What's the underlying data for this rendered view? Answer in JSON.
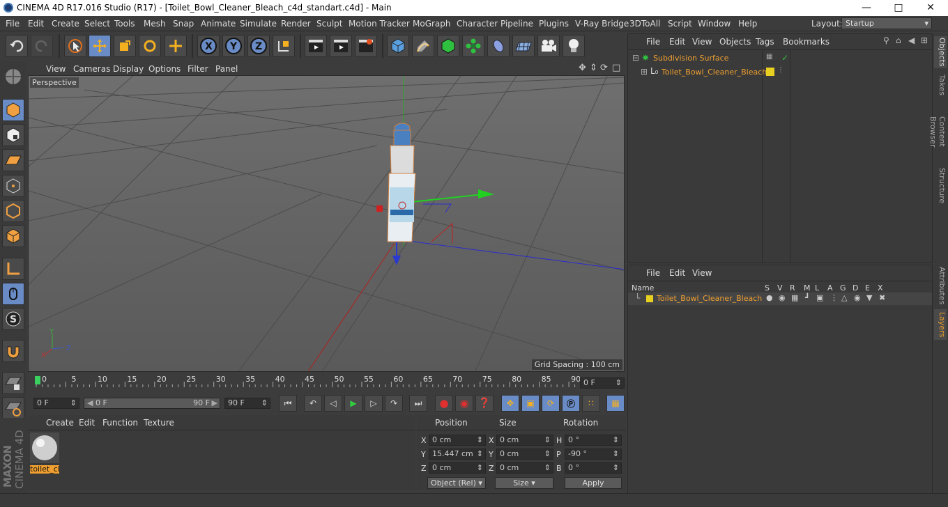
{
  "window": {
    "title": "CINEMA 4D R17.016 Studio (R17) - [Toilet_Bowl_Cleaner_Bleach_c4d_standart.c4d] - Main"
  },
  "menu": [
    "File",
    "Edit",
    "Create",
    "Select",
    "Tools",
    "Mesh",
    "Snap",
    "Animate",
    "Simulate",
    "Render",
    "Sculpt",
    "Motion Tracker",
    "MoGraph",
    "Character",
    "Pipeline",
    "Plugins",
    "V-Ray Bridge",
    "3DToAll",
    "Script",
    "Window",
    "Help"
  ],
  "layout": {
    "label": "Layout:",
    "value": "Startup"
  },
  "viewport": {
    "menu": [
      "View",
      "Cameras",
      "Display",
      "Options",
      "Filter",
      "Panel"
    ],
    "label": "Perspective",
    "grid_spacing": "Grid Spacing : 100 cm",
    "axis_x": "X",
    "axis_y": "Y",
    "axis_z": "Z"
  },
  "timeline": {
    "ticks": [
      "0",
      "5",
      "10",
      "15",
      "20",
      "25",
      "30",
      "35",
      "40",
      "45",
      "50",
      "55",
      "60",
      "65",
      "70",
      "75",
      "80",
      "85",
      "90"
    ],
    "current_frame": "0 F"
  },
  "controls": {
    "start": "0 F",
    "range_start": "0 F",
    "range_end": "90 F",
    "end": "90 F"
  },
  "material_panel": {
    "menu": [
      "Create",
      "Edit",
      "Function",
      "Texture"
    ],
    "material_name": "toilet_cl"
  },
  "coord_panel": {
    "headers": {
      "position": "Position",
      "size": "Size",
      "rotation": "Rotation"
    },
    "rows": [
      {
        "pl": "X",
        "pv": "0 cm",
        "sl": "X",
        "sv": "0 cm",
        "rl": "H",
        "rv": "0 °"
      },
      {
        "pl": "Y",
        "pv": "15.447 cm",
        "sl": "Y",
        "sv": "0 cm",
        "rl": "P",
        "rv": "-90 °"
      },
      {
        "pl": "Z",
        "pv": "0 cm",
        "sl": "Z",
        "sv": "0 cm",
        "rl": "B",
        "rv": "0 °"
      }
    ],
    "mode": "Object (Rel)",
    "size_mode": "Size",
    "apply": "Apply"
  },
  "object_panel": {
    "menu": [
      "File",
      "Edit",
      "View",
      "Objects",
      "Tags",
      "Bookmarks"
    ],
    "objects": [
      "Subdivision Surface",
      "Toilet_Bowl_Cleaner_Bleach"
    ]
  },
  "layer_panel": {
    "menu": [
      "File",
      "Edit",
      "View"
    ],
    "name_header": "Name",
    "columns": [
      "S",
      "V",
      "R",
      "M",
      "L",
      "A",
      "G",
      "D",
      "E",
      "X"
    ],
    "layer_name": "Toilet_Bowl_Cleaner_Bleach"
  },
  "side_tabs": [
    "Objects",
    "Takes",
    "Content Browser",
    "Structure",
    "Attributes",
    "Layers"
  ],
  "branding": {
    "maxon": "MAXON",
    "product": "CINEMA 4D"
  }
}
